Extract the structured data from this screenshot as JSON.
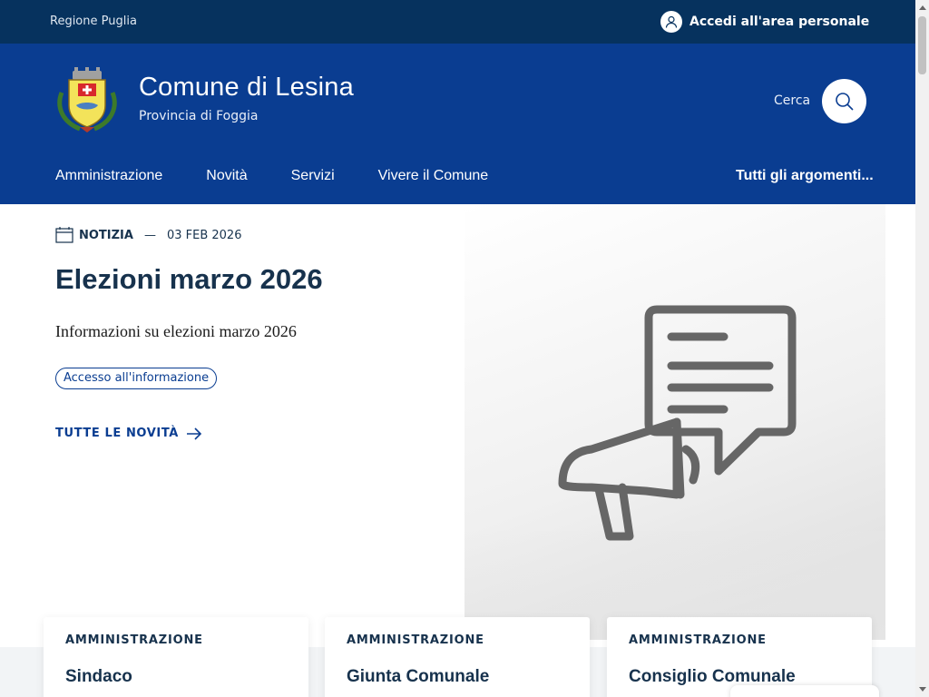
{
  "topbar": {
    "region": "Regione Puglia",
    "login_label": "Accedi all'area personale",
    "login_icon": "user-icon"
  },
  "header": {
    "title": "Comune di Lesina",
    "subtitle": "Provincia di Foggia",
    "search_label": "Cerca",
    "search_icon": "search-icon"
  },
  "nav": {
    "items": [
      "Amministrazione",
      "Novità",
      "Servizi",
      "Vivere il Comune"
    ],
    "topics": "Tutti gli argomenti..."
  },
  "hero": {
    "category": "NOTIZIA",
    "separator": "—",
    "date": "03 FEB 2026",
    "title": "Elezioni marzo 2026",
    "description": "Informazioni su elezioni marzo 2026",
    "tag": "Accesso all'informazione",
    "all_news": "TUTTE LE NOVITÀ",
    "image_icon": "megaphone-icon"
  },
  "cards": [
    {
      "tag": "AMMINISTRAZIONE",
      "title": "Sindaco"
    },
    {
      "tag": "AMMINISTRAZIONE",
      "title": "Giunta Comunale"
    },
    {
      "tag": "AMMINISTRAZIONE",
      "title": "Consiglio Comunale"
    }
  ],
  "colors": {
    "topbar": "#06325e",
    "header": "#0a3d91",
    "text_dark": "#17324d"
  }
}
